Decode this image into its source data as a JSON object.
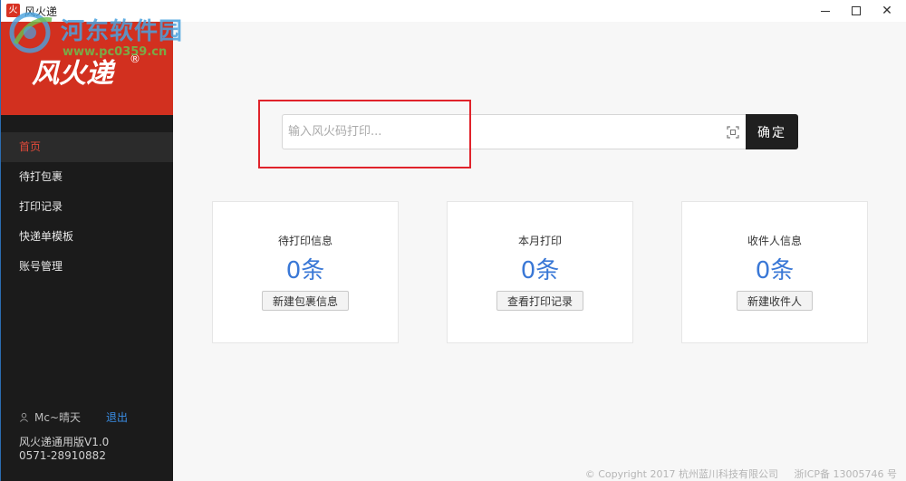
{
  "window": {
    "title": "风火递",
    "app_icon_glyph": "火",
    "controls": {
      "minimize_icon": "minimize-icon",
      "maximize_icon": "maximize-icon",
      "close_glyph": "✕"
    }
  },
  "watermark": {
    "text": "河东软件园",
    "url": "www.pc0359.cn"
  },
  "sidebar": {
    "brand": {
      "text": "风火递",
      "reg_mark": "®"
    },
    "items": [
      {
        "label": "首页",
        "active": true
      },
      {
        "label": "待打包裹",
        "active": false
      },
      {
        "label": "打印记录",
        "active": false
      },
      {
        "label": "快递单模板",
        "active": false
      },
      {
        "label": "账号管理",
        "active": false
      }
    ],
    "user": {
      "name": "Mc~晴天",
      "logout_label": "退出"
    },
    "version": "风火递通用版V1.0",
    "phone": "0571-28910882"
  },
  "search": {
    "placeholder": "输入风火码打印...",
    "value": "",
    "confirm_label": "确定"
  },
  "cards": [
    {
      "title": "待打印信息",
      "value": "0条",
      "button_label": "新建包裹信息"
    },
    {
      "title": "本月打印",
      "value": "0条",
      "button_label": "查看打印记录"
    },
    {
      "title": "收件人信息",
      "value": "0条",
      "button_label": "新建收件人"
    }
  ],
  "footer": {
    "copyright": "© Copyright 2017 杭州蓝川科技有限公司",
    "icp": "浙ICP备 13005746 号"
  },
  "colors": {
    "brand_red": "#d2301f",
    "sidebar_bg": "#1b1b1b",
    "active_nav_text": "#e04a3a",
    "value_blue": "#3a78d6",
    "logout_blue": "#3a8ee6",
    "highlight_red": "#e0232b"
  }
}
